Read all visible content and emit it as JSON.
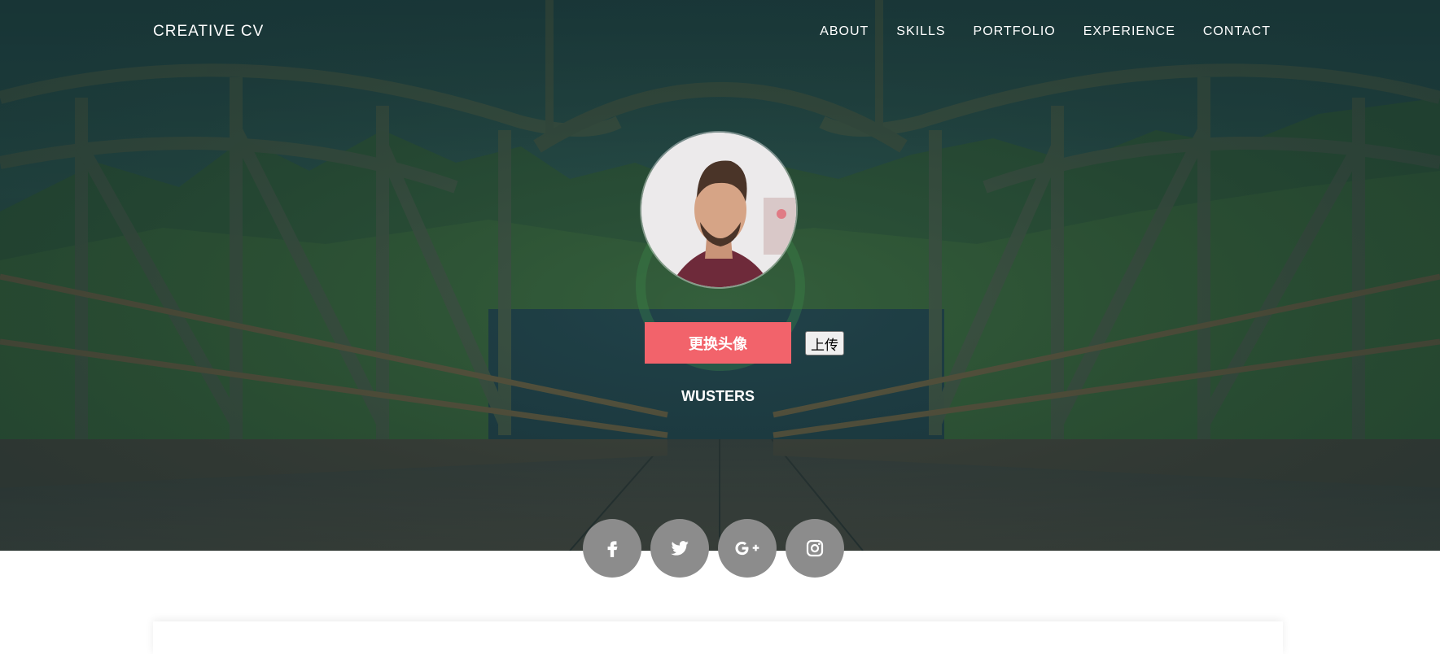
{
  "header": {
    "brand": "CREATIVE CV",
    "nav": [
      {
        "label": "ABOUT"
      },
      {
        "label": "SKILLS"
      },
      {
        "label": "PORTFOLIO"
      },
      {
        "label": "EXPERIENCE"
      },
      {
        "label": "CONTACT"
      }
    ]
  },
  "profile": {
    "change_avatar_label": "更换头像",
    "upload_label": "上传",
    "name": "WUSTERS"
  },
  "social": [
    {
      "icon": "facebook-icon"
    },
    {
      "icon": "twitter-icon"
    },
    {
      "icon": "google-plus-icon"
    },
    {
      "icon": "instagram-icon"
    }
  ],
  "colors": {
    "accent": "#f2636b",
    "social_circle": "#8c8c8c",
    "overlay": "#1b3f44"
  }
}
